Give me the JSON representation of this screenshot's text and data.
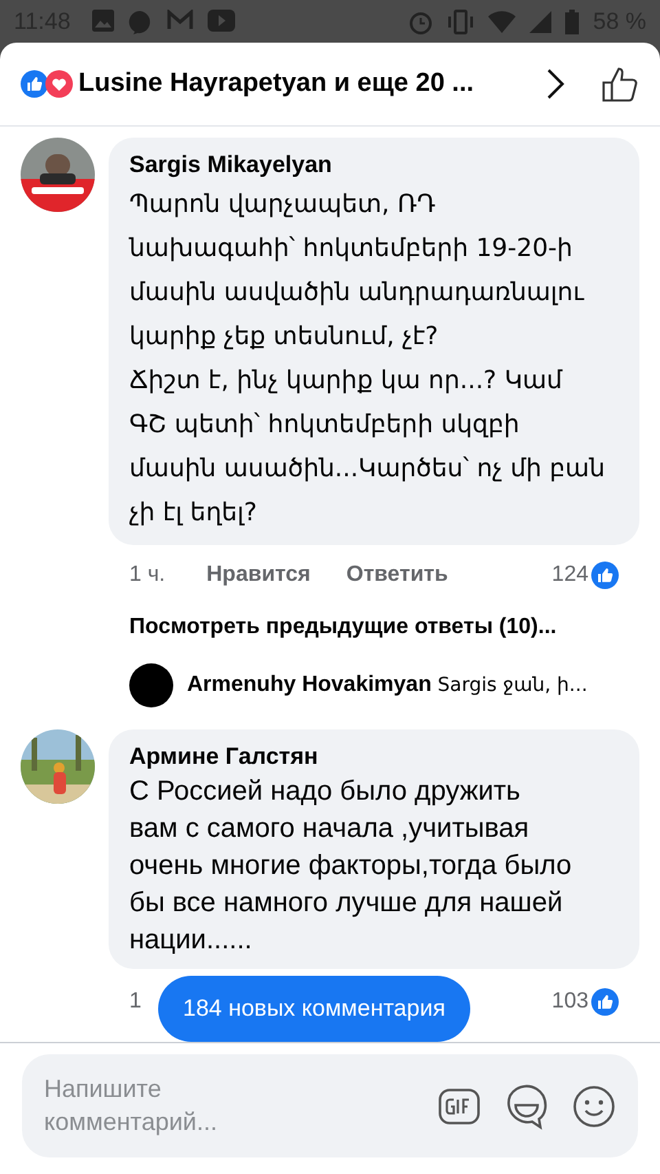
{
  "status_bar": {
    "time": "11:48",
    "battery": "58 %"
  },
  "header": {
    "title": "Lusine Hayrapetyan и еще 20 ..."
  },
  "comments": [
    {
      "author": "Sargis Mikayelyan",
      "text": "Պարոն վարչապետ, ՌԴ նախագահի՝ հոկտեմբերի 19-20-ի մասին ասվածին անդրադառնալու կարիք չեք տեսնում, չէ?\nՃիշտ է, ինչ կարիք կա որ...?  Կամ ԳՇ պետի՝ հոկտեմբերի  սկզբի մասին ասածին...Կարծես՝  ոչ մի բան չի էլ եղել?",
      "time": "1 ч.",
      "like": "Нравится",
      "reply": "Ответить",
      "likes": "124",
      "more_replies": "Посмотреть предыдущие ответы (10)...",
      "last_reply": {
        "author": "Armenuhy Hovakimyan",
        "text": "Sargis ջան, ի..."
      }
    },
    {
      "author": "Армине Галстян",
      "text": "С Россией надо было дружить вам с самого начала ,учитывая очень многие факторы,тогда было бы все намного лучше для нашей нации......",
      "time": "1",
      "likes": "103"
    }
  ],
  "new_comments_button": "184 новых комментария",
  "composer": {
    "placeholder": "Напишите комментарий..."
  }
}
